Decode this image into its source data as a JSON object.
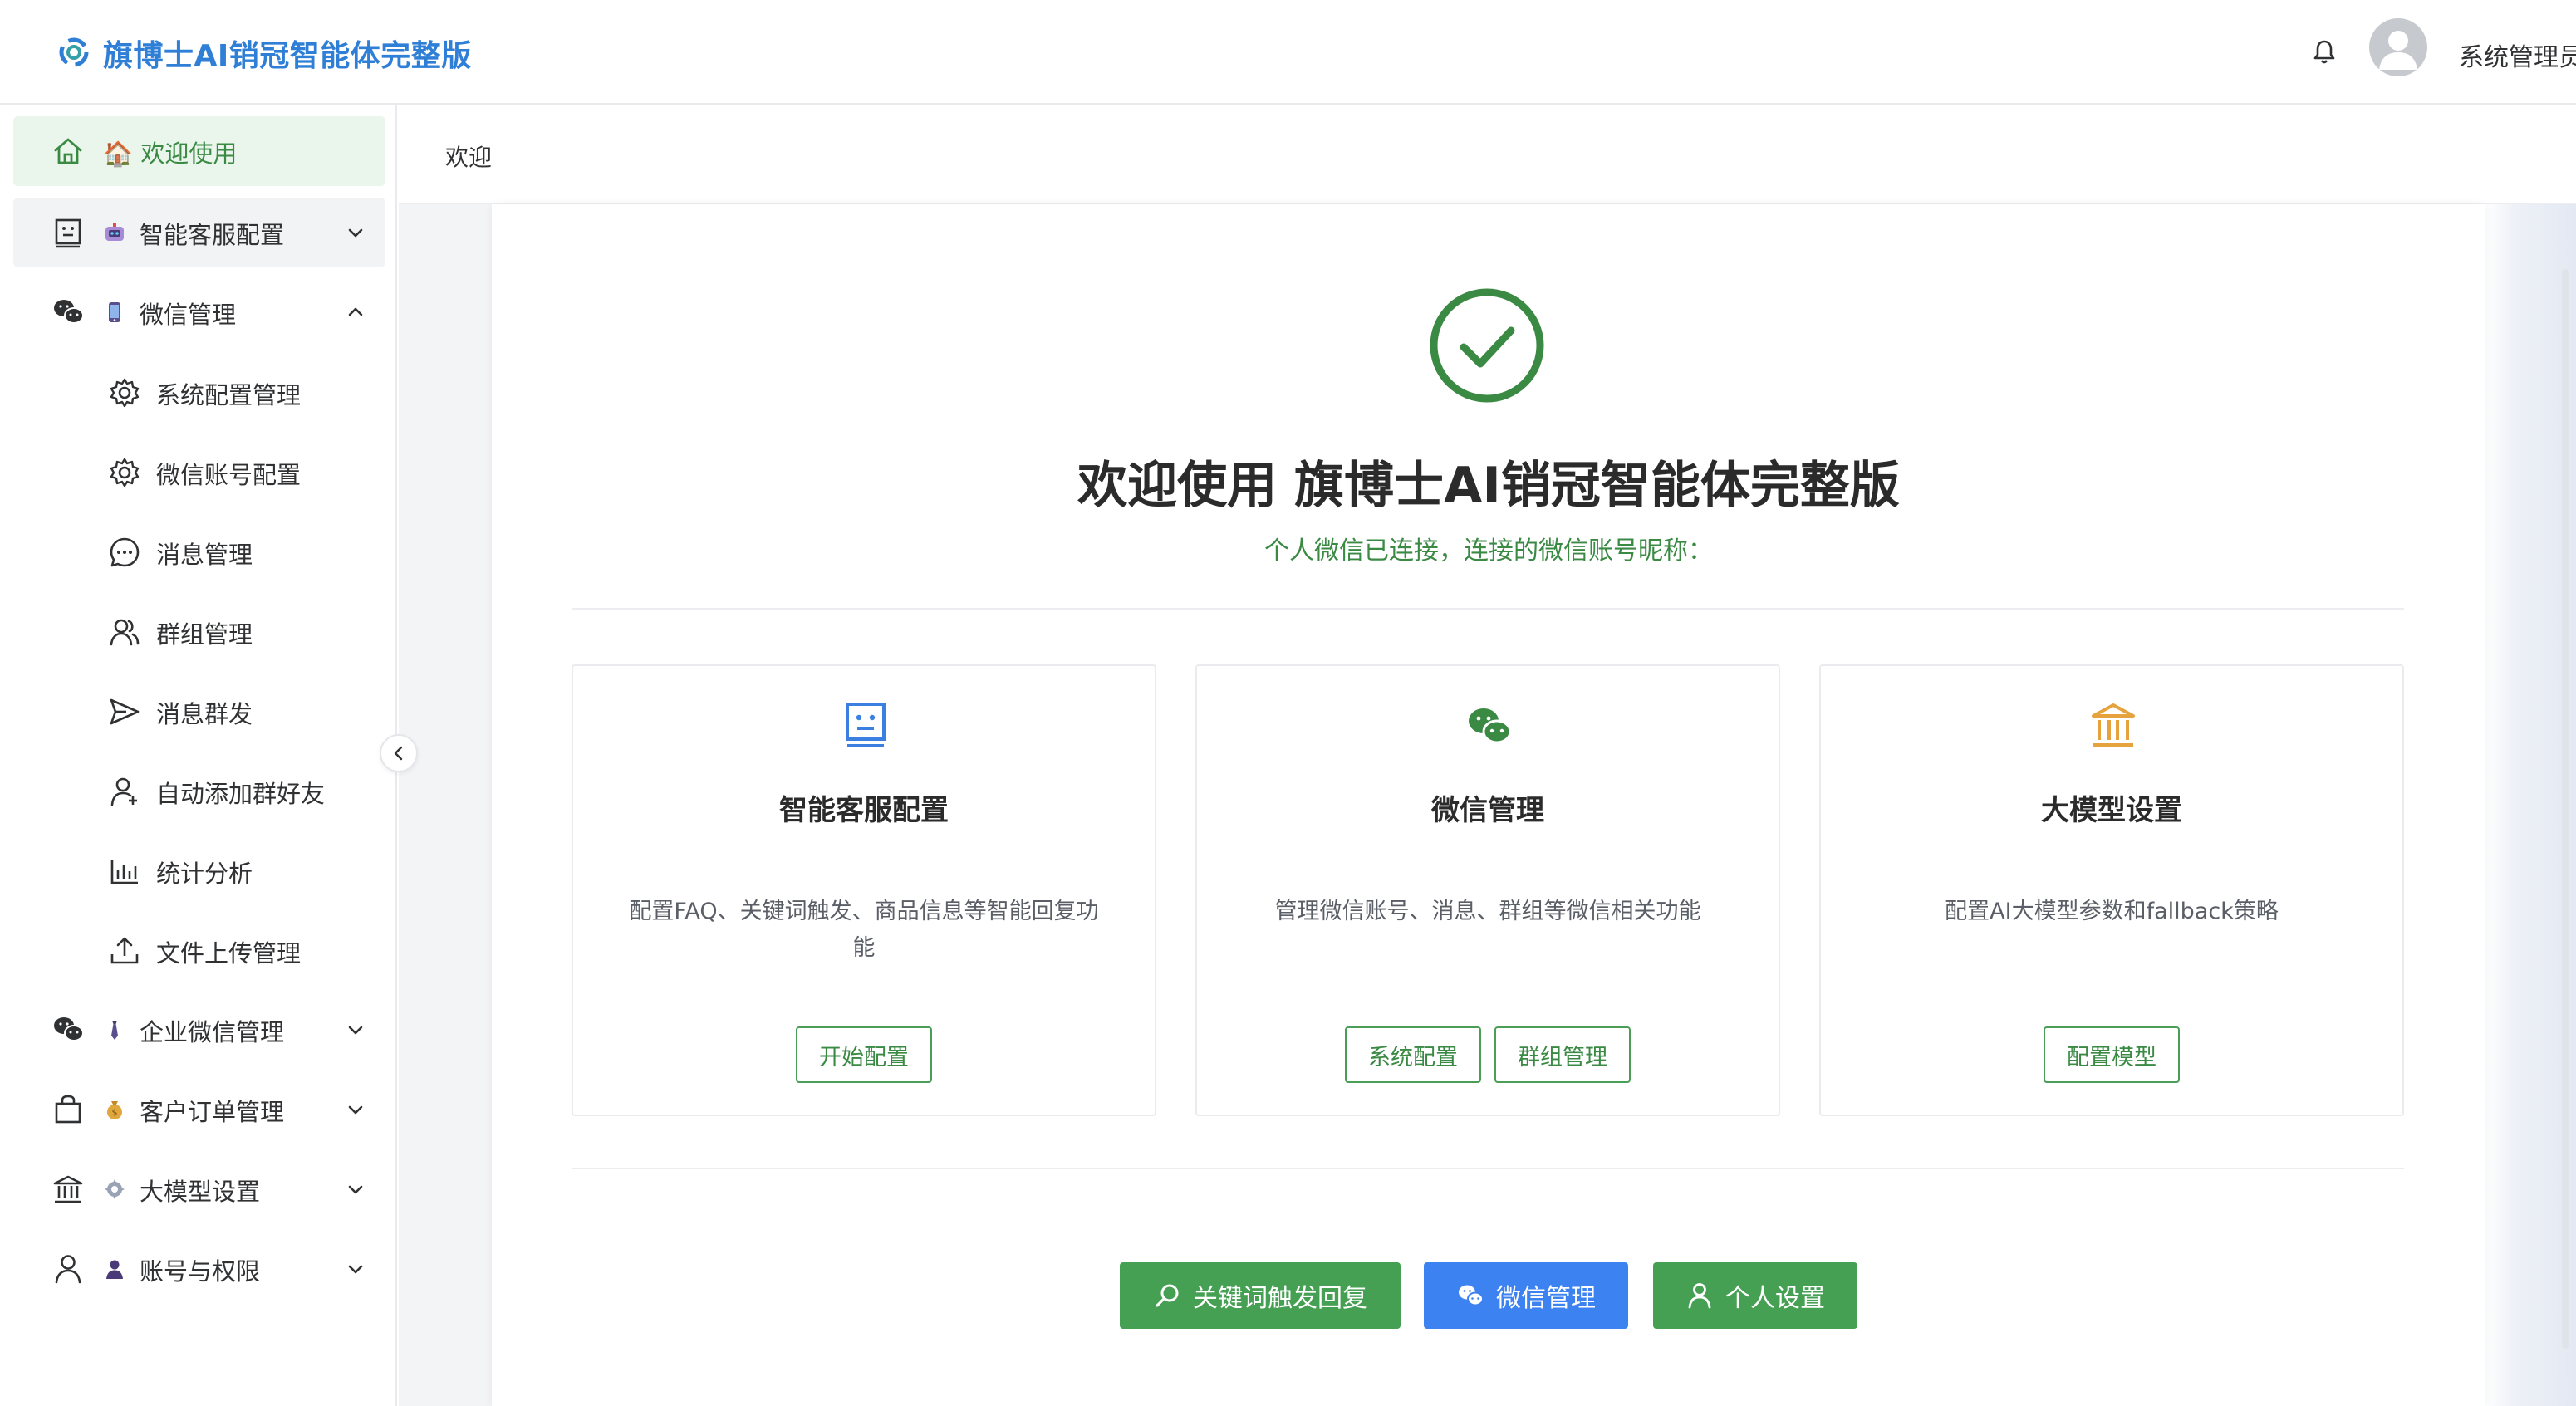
{
  "header": {
    "app_title": "旗博士AI销冠智能体完整版",
    "user_name": "系统管理员"
  },
  "sidebar": {
    "items": [
      {
        "label": "🏠 欢迎使用",
        "icon": "home-icon",
        "active": true
      },
      {
        "label": "智能客服配置",
        "icon": "robot-icon",
        "expanded": false
      },
      {
        "label": "微信管理",
        "icon": "wechat-icon",
        "expanded": true
      },
      {
        "label": "企业微信管理",
        "icon": "wechat-icon",
        "expanded": false
      },
      {
        "label": "客户订单管理",
        "icon": "shopping-bag-icon",
        "expanded": false
      },
      {
        "label": "大模型设置",
        "icon": "bank-icon",
        "expanded": false
      },
      {
        "label": "账号与权限",
        "icon": "user-icon",
        "expanded": false
      }
    ],
    "wechat_subitems": [
      {
        "label": "系统配置管理",
        "icon": "gear-icon"
      },
      {
        "label": "微信账号配置",
        "icon": "gear-icon"
      },
      {
        "label": "消息管理",
        "icon": "chat-bubble-icon"
      },
      {
        "label": "群组管理",
        "icon": "group-icon"
      },
      {
        "label": "消息群发",
        "icon": "send-icon"
      },
      {
        "label": "自动添加群好友",
        "icon": "user-add-icon"
      },
      {
        "label": "统计分析",
        "icon": "bar-chart-icon"
      },
      {
        "label": "文件上传管理",
        "icon": "upload-icon"
      }
    ]
  },
  "breadcrumb": {
    "current": "欢迎"
  },
  "welcome": {
    "title": "欢迎使用 旗博士AI销冠智能体完整版",
    "status": "个人微信已连接，连接的微信账号昵称："
  },
  "features": [
    {
      "title": "智能客服配置",
      "description": "配置FAQ、关键词触发、商品信息等智能回复功能",
      "icon": "robot-icon",
      "icon_color": "#3b7fe0",
      "buttons": [
        "开始配置"
      ]
    },
    {
      "title": "微信管理",
      "description": "管理微信账号、消息、群组等微信相关功能",
      "icon": "wechat-icon",
      "icon_color": "#3a8a44",
      "buttons": [
        "系统配置",
        "群组管理"
      ]
    },
    {
      "title": "大模型设置",
      "description": "配置AI大模型参数和fallback策略",
      "icon": "bank-icon",
      "icon_color": "#e6a23c",
      "buttons": [
        "配置模型"
      ]
    }
  ],
  "actions": [
    {
      "label": "关键词触发回复",
      "icon": "search-icon",
      "color": "#46a053"
    },
    {
      "label": "微信管理",
      "icon": "wechat-icon",
      "color": "#3c82f0"
    },
    {
      "label": "个人设置",
      "icon": "user-icon",
      "color": "#46a053"
    }
  ],
  "colors": {
    "accent_green": "#3a8a44",
    "brand_blue": "#2f7fd6",
    "warning_orange": "#e6a23c"
  }
}
